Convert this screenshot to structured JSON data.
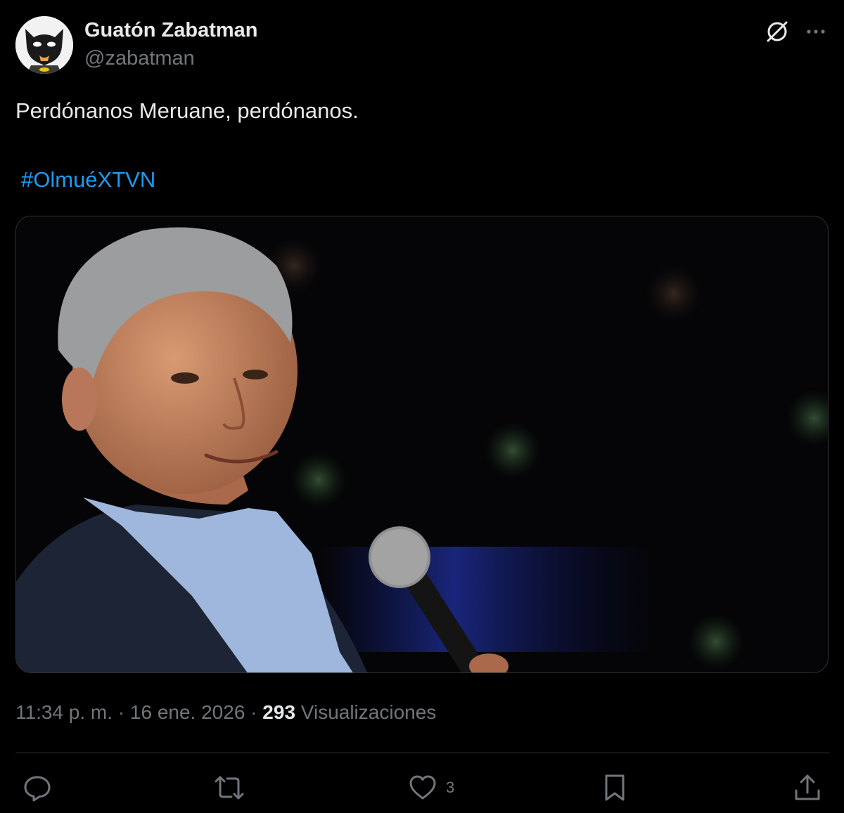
{
  "author": {
    "name": "Guatón Zabatman",
    "handle": "@zabatman",
    "avatar_icon": "batman-mask-avatar"
  },
  "header_actions": {
    "grok_icon": "grok-icon",
    "more_icon": "more-icon"
  },
  "tweet": {
    "text": "Perdónanos Meruane, perdónanos.",
    "hashtag": "#OlmuéXTVN"
  },
  "media": {
    "type": "photo",
    "description_icon": "photo"
  },
  "meta": {
    "time": "11:34 p. m.",
    "separator": " · ",
    "date": "16 ene. 2026",
    "views_count": "293",
    "views_label": "Visualizaciones"
  },
  "actions": {
    "reply": {
      "icon": "reply-icon",
      "count": ""
    },
    "repost": {
      "icon": "repost-icon",
      "count": ""
    },
    "like": {
      "icon": "heart-icon",
      "count": "3"
    },
    "bookmark": {
      "icon": "bookmark-icon",
      "count": ""
    },
    "share": {
      "icon": "share-icon",
      "count": ""
    }
  },
  "colors": {
    "background": "#000000",
    "text": "#e7e9ea",
    "secondary": "#71767b",
    "link": "#1d9bf0",
    "border": "#2f3336"
  }
}
